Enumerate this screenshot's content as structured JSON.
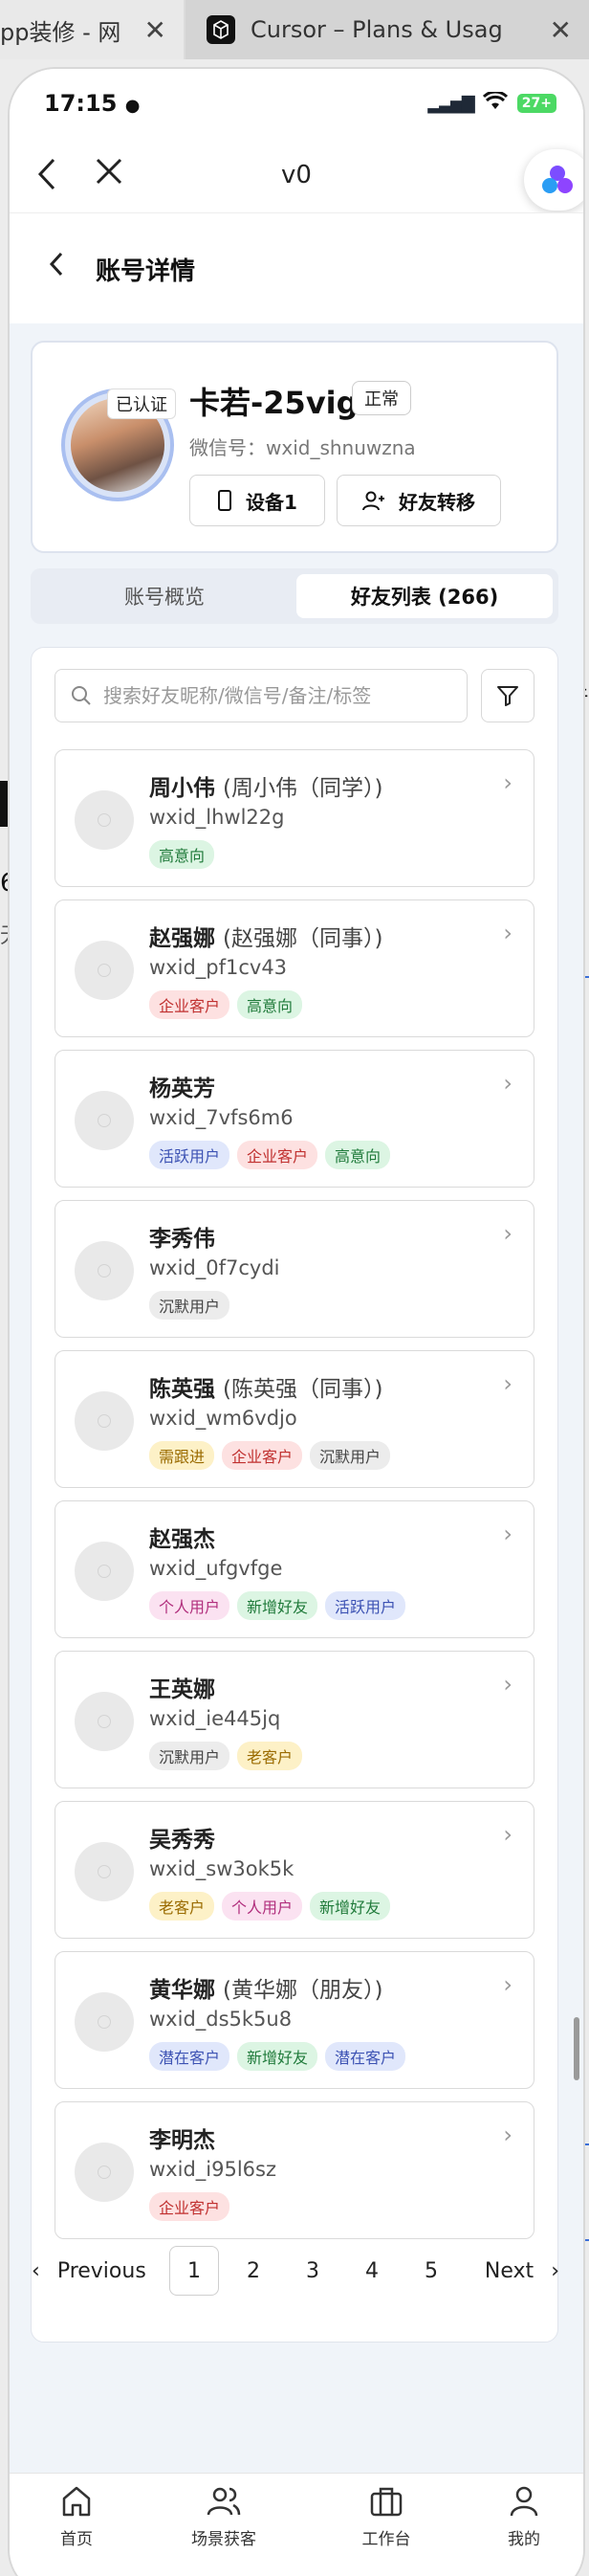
{
  "browser": {
    "tabs": [
      {
        "title": "pp装修 - 网"
      },
      {
        "title": "Cursor – Plans & Usag"
      }
    ]
  },
  "background_peek": {
    "right_char": "着",
    "left_digit": "6",
    "left_char": "无"
  },
  "status_bar": {
    "time": "17:15",
    "battery": "27+"
  },
  "nav": {
    "title": "v0"
  },
  "page": {
    "title": "账号详情"
  },
  "profile": {
    "name": "卡若-25vig",
    "status": "正常",
    "cert": "已认证",
    "wechat_label": "微信号：",
    "wechat_id": "wxid_shnuwzna",
    "device_button": "设备1",
    "transfer_button": "好友转移"
  },
  "tabs": {
    "overview": "账号概览",
    "friends": "好友列表 (266)"
  },
  "search": {
    "placeholder": "搜索好友昵称/微信号/备注/标签"
  },
  "friends": [
    {
      "name": "周小伟",
      "remark": "(周小伟（同学）)",
      "wxid": "wxid_lhwl22g",
      "tags": [
        {
          "text": "高意向",
          "color": "green"
        }
      ]
    },
    {
      "name": "赵强娜",
      "remark": "(赵强娜（同事）)",
      "wxid": "wxid_pf1cv43",
      "tags": [
        {
          "text": "企业客户",
          "color": "red"
        },
        {
          "text": "高意向",
          "color": "green"
        }
      ]
    },
    {
      "name": "杨英芳",
      "remark": "",
      "wxid": "wxid_7vfs6m6",
      "tags": [
        {
          "text": "活跃用户",
          "color": "blue"
        },
        {
          "text": "企业客户",
          "color": "red"
        },
        {
          "text": "高意向",
          "color": "green"
        }
      ]
    },
    {
      "name": "李秀伟",
      "remark": "",
      "wxid": "wxid_0f7cydi",
      "tags": [
        {
          "text": "沉默用户",
          "color": "gray"
        }
      ]
    },
    {
      "name": "陈英强",
      "remark": "(陈英强（同事）)",
      "wxid": "wxid_wm6vdjo",
      "tags": [
        {
          "text": "需跟进",
          "color": "yellow"
        },
        {
          "text": "企业客户",
          "color": "red"
        },
        {
          "text": "沉默用户",
          "color": "gray"
        }
      ]
    },
    {
      "name": "赵强杰",
      "remark": "",
      "wxid": "wxid_ufgvfge",
      "tags": [
        {
          "text": "个人用户",
          "color": "pink"
        },
        {
          "text": "新增好友",
          "color": "green"
        },
        {
          "text": "活跃用户",
          "color": "blue"
        }
      ]
    },
    {
      "name": "王英娜",
      "remark": "",
      "wxid": "wxid_ie445jq",
      "tags": [
        {
          "text": "沉默用户",
          "color": "gray"
        },
        {
          "text": "老客户",
          "color": "yellow"
        }
      ]
    },
    {
      "name": "吴秀秀",
      "remark": "",
      "wxid": "wxid_sw3ok5k",
      "tags": [
        {
          "text": "老客户",
          "color": "yellow"
        },
        {
          "text": "个人用户",
          "color": "pink"
        },
        {
          "text": "新增好友",
          "color": "green"
        }
      ]
    },
    {
      "name": "黄华娜",
      "remark": "(黄华娜（朋友）)",
      "wxid": "wxid_ds5k5u8",
      "tags": [
        {
          "text": "潜在客户",
          "color": "blue"
        },
        {
          "text": "新增好友",
          "color": "green"
        },
        {
          "text": "潜在客户",
          "color": "blue"
        }
      ]
    },
    {
      "name": "李明杰",
      "remark": "",
      "wxid": "wxid_i95l6sz",
      "tags": [
        {
          "text": "企业客户",
          "color": "red"
        }
      ]
    }
  ],
  "pagination": {
    "prev": "Previous",
    "next": "Next",
    "pages": [
      "1",
      "2",
      "3",
      "4",
      "5"
    ],
    "current": "1"
  },
  "tabbar": [
    {
      "label": "首页",
      "icon": "home-icon"
    },
    {
      "label": "场景获客",
      "icon": "users-icon"
    },
    {
      "label": "工作台",
      "icon": "briefcase-icon"
    },
    {
      "label": "我的",
      "icon": "user-icon"
    }
  ]
}
